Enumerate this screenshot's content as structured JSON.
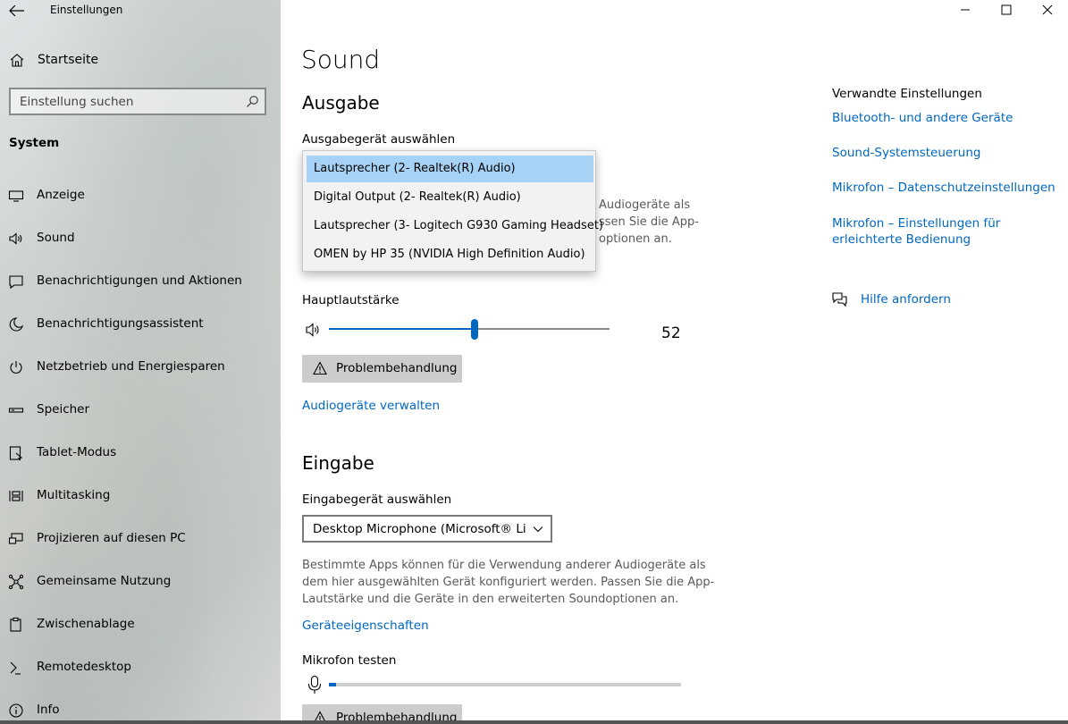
{
  "window": {
    "title": "Einstellungen",
    "controls": [
      "minimize-icon",
      "maximize-icon",
      "close-icon"
    ]
  },
  "sidebar": {
    "home_label": "Startseite",
    "search_placeholder": "Einstellung suchen",
    "section_title": "System",
    "items": [
      {
        "label": "Anzeige",
        "icon": "display-icon"
      },
      {
        "label": "Sound",
        "icon": "speaker-icon"
      },
      {
        "label": "Benachrichtigungen und Aktionen",
        "icon": "notification-icon"
      },
      {
        "label": "Benachrichtigungsassistent",
        "icon": "moon-icon"
      },
      {
        "label": "Netzbetrieb und Energiesparen",
        "icon": "power-icon"
      },
      {
        "label": "Speicher",
        "icon": "storage-icon"
      },
      {
        "label": "Tablet-Modus",
        "icon": "tablet-icon"
      },
      {
        "label": "Multitasking",
        "icon": "multitasking-icon"
      },
      {
        "label": "Projizieren auf diesen PC",
        "icon": "project-icon"
      },
      {
        "label": "Gemeinsame Nutzung",
        "icon": "share-icon"
      },
      {
        "label": "Zwischenablage",
        "icon": "clipboard-icon"
      },
      {
        "label": "Remotedesktop",
        "icon": "remote-icon"
      },
      {
        "label": "Info",
        "icon": "info-icon"
      }
    ]
  },
  "main": {
    "title": "Sound",
    "output": {
      "heading": "Ausgabe",
      "device_label": "Ausgabegerät auswählen",
      "dropdown_options": [
        "Lautsprecher (2- Realtek(R) Audio)",
        "Digital Output (2- Realtek(R) Audio)",
        "Lautsprecher (3- Logitech G930 Gaming Headset)",
        "OMEN by HP 35 (NVIDIA High Definition Audio)"
      ],
      "selected_index": 0,
      "hidden_desc_lines": [
        "Audiogeräte als",
        "ssen Sie die App-",
        "optionen an."
      ],
      "volume_label": "Hauptlautstärke",
      "volume_value": "52",
      "volume_fraction": 0.52,
      "troubleshoot_label": "Problembehandlung",
      "manage_link": "Audiogeräte verwalten"
    },
    "input": {
      "heading": "Eingabe",
      "device_label": "Eingabegerät auswählen",
      "selected_device": "Desktop Microphone (Microsoft® Li...",
      "description": "Bestimmte Apps können für die Verwendung anderer Audiogeräte als dem hier ausgewählten Gerät konfiguriert werden. Passen Sie die App-Lautstärke und die Geräte in den erweiterten Soundoptionen an.",
      "desc_lines": [
        "Bestimmte Apps können für die Verwendung anderer Audiogeräte als",
        "dem hier ausgewählten Gerät konfiguriert werden. Passen Sie die App-",
        "Lautstärke und die Geräte in den erweiterten Soundoptionen an."
      ],
      "properties_link": "Geräteeigenschaften",
      "mic_test_label": "Mikrofon testen",
      "mic_level_fraction": 0.02,
      "troubleshoot_label": "Problembehandlung"
    }
  },
  "related": {
    "title": "Verwandte Einstellungen",
    "links": [
      "Bluetooth- und andere Geräte",
      "Sound-Systemsteuerung",
      "Mikrofon – Datenschutzeinstellungen",
      "Mikrofon – Einstellungen für",
      "erleichterte Bedienung"
    ],
    "help_label": "Hilfe anfordern"
  },
  "colors": {
    "accent": "#0067c0",
    "selection": "#a6d2f5",
    "button_gray": "#cccccc"
  }
}
